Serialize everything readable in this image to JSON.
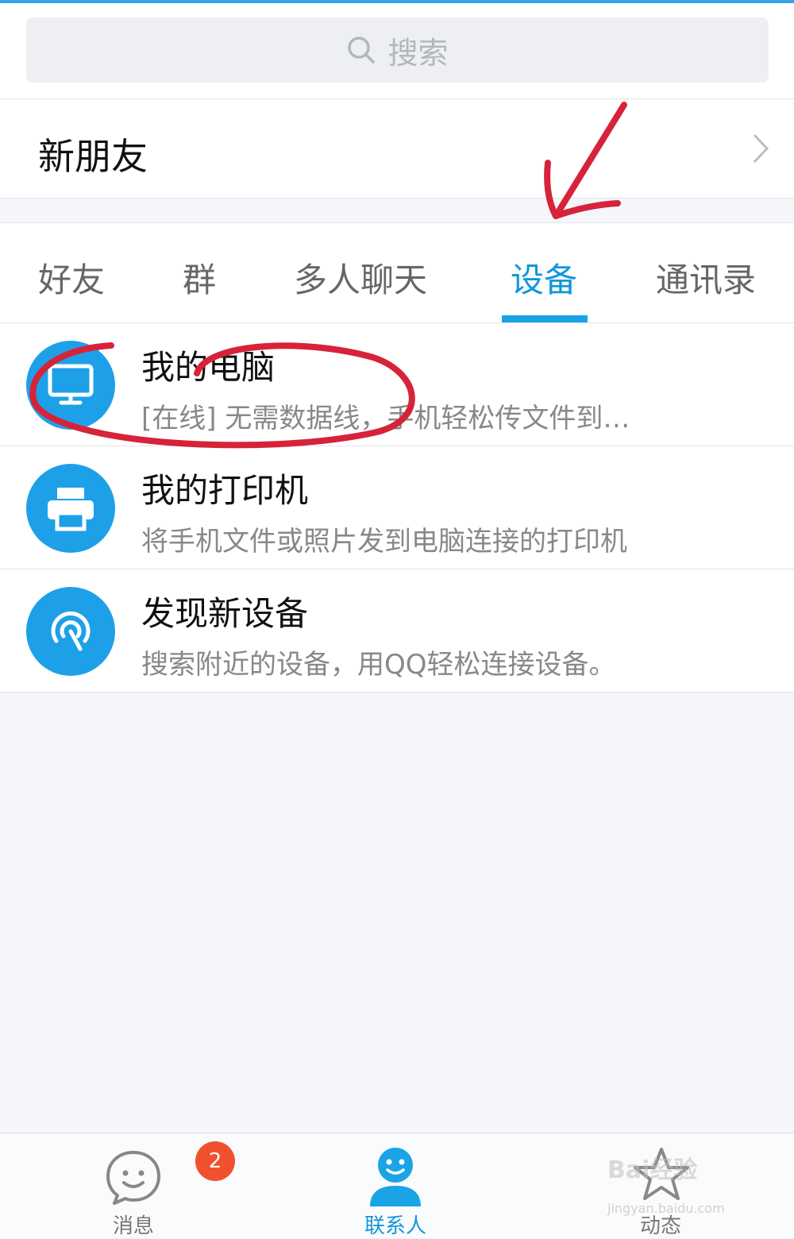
{
  "search": {
    "placeholder": "搜索"
  },
  "new_friends": {
    "label": "新朋友"
  },
  "tabs": [
    {
      "label": "好友",
      "active": false
    },
    {
      "label": "群",
      "active": false
    },
    {
      "label": "多人聊天",
      "active": false
    },
    {
      "label": "设备",
      "active": true
    },
    {
      "label": "通讯录",
      "active": false
    }
  ],
  "devices": [
    {
      "title": "我的电脑",
      "subtitle": "[在线] 无需数据线，手机轻松传文件到…",
      "icon": "monitor-icon"
    },
    {
      "title": "我的打印机",
      "subtitle": "将手机文件或照片发到电脑连接的打印机",
      "icon": "printer-icon"
    },
    {
      "title": "发现新设备",
      "subtitle": "搜索附近的设备，用QQ轻松连接设备。",
      "icon": "radar-icon"
    }
  ],
  "bottom_nav": [
    {
      "label": "消息",
      "badge": "2",
      "icon": "chat-smile-icon",
      "active": false
    },
    {
      "label": "联系人",
      "icon": "contacts-icon",
      "active": true
    },
    {
      "label": "动态",
      "icon": "star-icon",
      "active": false
    }
  ],
  "watermark": {
    "brand": "Bai经验",
    "url": "jingyan.baidu.com"
  },
  "colors": {
    "accent": "#1296db",
    "avatar_bg": "#1ea0e8",
    "badge": "#f0512f",
    "annotation": "#d6233a"
  }
}
